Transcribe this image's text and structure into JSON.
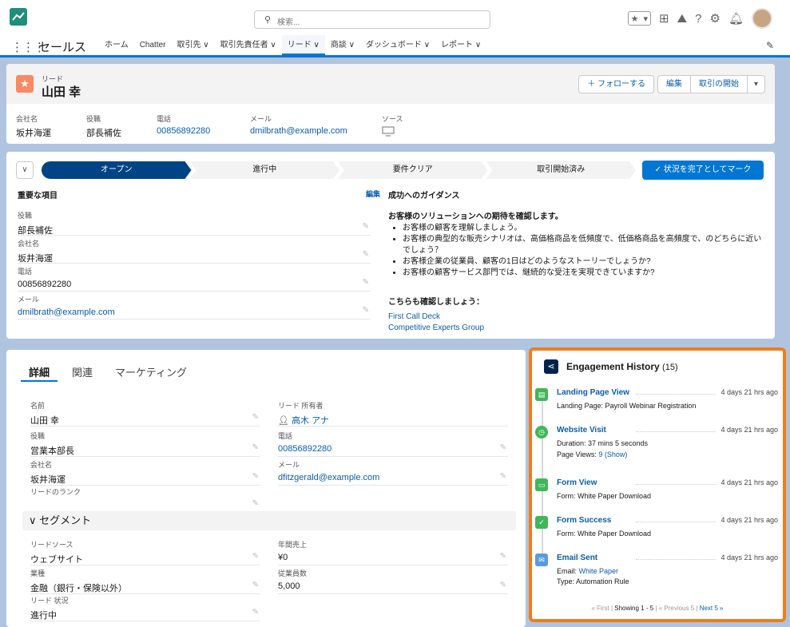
{
  "header": {
    "search_placeholder": "検索...",
    "fav_star": "★",
    "fav_caret": "▾"
  },
  "nav": {
    "app_name": "セールス",
    "items": [
      {
        "label": "ホーム"
      },
      {
        "label": "Chatter"
      },
      {
        "label": "取引先 ∨"
      },
      {
        "label": "取引先責任者 ∨"
      },
      {
        "label": "リード ∨"
      },
      {
        "label": "商談 ∨"
      },
      {
        "label": "ダッシュボード ∨"
      },
      {
        "label": "レポート ∨"
      }
    ]
  },
  "record": {
    "object_label": "リード",
    "name": "山田 幸",
    "follow_label": "＋ フォローする",
    "edit_label": "編集",
    "convert_label": "取引の開始",
    "more_label": "▾",
    "highlights": [
      {
        "label": "会社名",
        "value": "坂井海運"
      },
      {
        "label": "役職",
        "value": "部長補佐"
      },
      {
        "label": "電話",
        "value": "00856892280"
      },
      {
        "label": "メール",
        "value": "dmilbrath@example.com"
      },
      {
        "label": "ソース",
        "value": ""
      }
    ]
  },
  "path": {
    "steps": [
      {
        "label": "オープン"
      },
      {
        "label": "進行中"
      },
      {
        "label": "要件クリア"
      },
      {
        "label": "取引開始済み"
      }
    ],
    "mark_complete_label": "✓ 状況を完了としてマーク"
  },
  "key_fields": {
    "title": "重要な項目",
    "edit_label": "編集",
    "fields": [
      {
        "label": "役職",
        "value": "部長補佐"
      },
      {
        "label": "会社名",
        "value": "坂井海運"
      },
      {
        "label": "電話",
        "value": "00856892280"
      },
      {
        "label": "メール",
        "value": "dmilbrath@example.com"
      }
    ]
  },
  "guidance": {
    "title": "成功へのガイダンス",
    "heading": "お客様のソリューションへの期待を確認します。",
    "bullets": [
      "お客様の顧客を理解しましょう。",
      "お客様の典型的な販売シナリオは、高価格商品を低頻度で、低価格商品を高頻度で、のどちらに近いでしょう？",
      "お客様企業の従業員、顧客の1日はどのようなストーリーでしょうか?",
      "お客様の顧客サービス部門では、継続的な受注を実現できていますか?"
    ],
    "also_heading": "こちらも確認しましょう：",
    "links": [
      "First Call Deck",
      "Competitive Experts Group"
    ]
  },
  "details": {
    "tabs": [
      "詳細",
      "関連",
      "マーケティング"
    ],
    "left": [
      {
        "label": "名前",
        "value": "山田 幸"
      },
      {
        "label": "役職",
        "value": "営業本部長"
      },
      {
        "label": "会社名",
        "value": "坂井海運"
      },
      {
        "label": "リードのランク",
        "value": ""
      }
    ],
    "right": [
      {
        "label": "リード 所有者",
        "value": "高木 アナ"
      },
      {
        "label": "電話",
        "value": "00856892280"
      },
      {
        "label": "メール",
        "value": "dfitzgerald@example.com"
      }
    ],
    "segment_title": "∨ セグメント",
    "seg_left": [
      {
        "label": "リードソース",
        "value": "ウェブサイト"
      },
      {
        "label": "業種",
        "value": "金融（銀行・保険以外）"
      },
      {
        "label": "リード 状況",
        "value": "進行中"
      }
    ],
    "seg_right": [
      {
        "label": "年間売上",
        "value": "¥0"
      },
      {
        "label": "従業員数",
        "value": "5,000"
      }
    ]
  },
  "engagement": {
    "title": "Engagement History",
    "count": "(15)",
    "events": [
      {
        "title": "Landing Page View",
        "time": "4 days 21 hrs ago",
        "color": "#41b658",
        "lines": [
          {
            "pre": "Landing Page: Payroll Webinar Registration",
            "link": ""
          }
        ]
      },
      {
        "title": "Website Visit",
        "time": "4 days 21 hrs ago",
        "color": "#41b658",
        "lines": [
          {
            "pre": "Duration: 37 mins 5 seconds",
            "link": ""
          },
          {
            "pre": "Page Views:",
            "link": "9 (Show)"
          }
        ]
      },
      {
        "title": "Form View",
        "time": "4 days 21 hrs ago",
        "color": "#41b658",
        "lines": [
          {
            "pre": "Form: White Paper Download",
            "link": ""
          }
        ]
      },
      {
        "title": "Form Success",
        "time": "4 days 21 hrs ago",
        "color": "#41b658",
        "lines": [
          {
            "pre": "Form: White Paper Download",
            "link": ""
          }
        ]
      },
      {
        "title": "Email Sent",
        "time": "4 days 21 hrs ago",
        "color": "#5a9bdc",
        "lines": [
          {
            "pre": "Email:",
            "link": "White Paper"
          },
          {
            "pre": "Type: Automation Rule",
            "link": ""
          }
        ]
      }
    ],
    "pager": {
      "first": "« First",
      "showing": "Showing 1 - 5",
      "prev": "« Previous 5",
      "next": "Next 5 »"
    }
  }
}
